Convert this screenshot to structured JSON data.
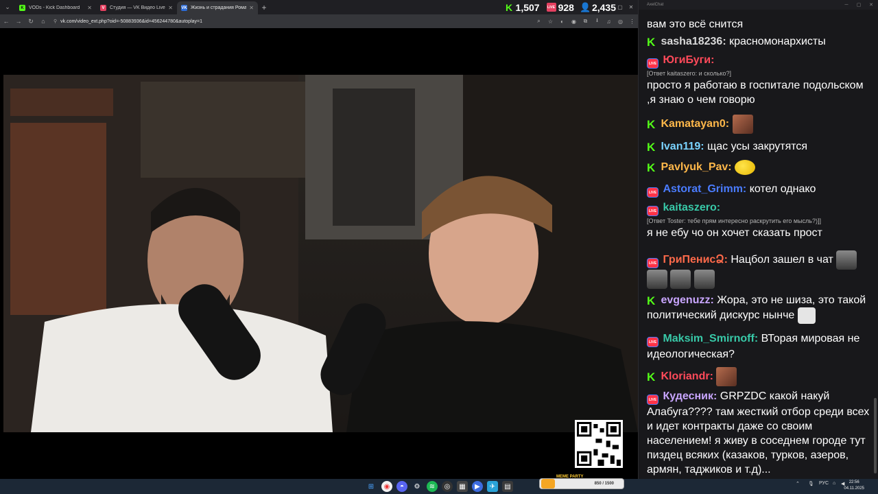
{
  "browser": {
    "tabs": [
      {
        "title": "VODs - Kick Dashboard",
        "favicon_color": "#53fc18",
        "favicon_glyph": "K"
      },
      {
        "title": "Студия — VK Видео Live",
        "favicon_color": "#e54060",
        "favicon_glyph": "V"
      },
      {
        "title": "Жизнь и страдания Рома...",
        "favicon_color": "#2b6bd8",
        "favicon_glyph": "VK",
        "active": true
      }
    ],
    "url": "vk.com/video_ext.php?oid=-50883936&id=456244780&autoplay=1",
    "stats": {
      "kick_viewers": "1,507",
      "vk_viewers": "928",
      "total_viewers": "2,435"
    }
  },
  "chat": {
    "window_title": "AxelChat",
    "messages": [
      {
        "platform": "",
        "nick": "",
        "nick_color": "#ffffff",
        "reply": "",
        "text": "вам это всё снится",
        "emote": ""
      },
      {
        "platform": "kick",
        "nick": "sasha18236:",
        "nick_color": "#d9d9d9",
        "reply": "",
        "text": "красномонархисты",
        "emote": ""
      },
      {
        "platform": "vk",
        "nick": "ЮгиБуги:",
        "nick_color": "#ff4a5a",
        "reply": "[Ответ kaitaszero: и сколько?]",
        "text": "просто я работаю в госпитале подольском ,я знаю о чем говорю",
        "emote": ""
      },
      {
        "platform": "kick",
        "nick": "Kamatayan0:",
        "nick_color": "#ffb84a",
        "reply": "",
        "text": "",
        "emote": "face"
      },
      {
        "platform": "kick",
        "nick": "Ivan119:",
        "nick_color": "#7ad3ff",
        "reply": "",
        "text": "щас усы закрутятся",
        "emote": ""
      },
      {
        "platform": "kick",
        "nick": "Pavlyuk_Pav:",
        "nick_color": "#ffb84a",
        "reply": "",
        "text": "",
        "emote": "yellow"
      },
      {
        "platform": "vk",
        "nick": "Astorat_Grimm:",
        "nick_color": "#4a7cff",
        "reply": "",
        "text": "котел однако",
        "emote": ""
      },
      {
        "platform": "vk",
        "nick": "kaitaszero:",
        "nick_color": "#38c9a8",
        "reply": "[Ответ Toster: тебе прям интересно раскрутить его мысль?)]]",
        "text": "я не ебу чо он хочет сказать прост",
        "emote": ""
      },
      {
        "platform": "vk",
        "nick": "ГриПенисՁ:",
        "nick_color": "#ff6a4a",
        "reply": "",
        "text": "Нацбол зашел в чат",
        "emote": "pepe"
      },
      {
        "platform": "kick",
        "nick": "evgenuzz:",
        "nick_color": "#c9a6ff",
        "reply": "",
        "text": "Жора, это не шиза, это такой политический дискурс нынче",
        "emote": "meme"
      },
      {
        "platform": "vk",
        "nick": "Maksim_Smirnoff:",
        "nick_color": "#38c9a8",
        "reply": "",
        "text": "ВТорая мировая не идеологическая?",
        "emote": ""
      },
      {
        "platform": "kick",
        "nick": "Kloriandr:",
        "nick_color": "#ff4a5a",
        "reply": "",
        "text": "",
        "emote": "face"
      },
      {
        "platform": "vk",
        "nick": "Кудесник:",
        "nick_color": "#c9a6ff",
        "reply": "",
        "text": "GRPZDC какой накуй Алабуга???? там жесткий отбор среди всех и идет контракты даже со своим населением! я живу в соседнем городе тут пиздец всяких (казаков, турков, азеров, армян, таджиков и т.д)...",
        "emote": ""
      }
    ]
  },
  "taskbar": {
    "meme_party_label": "MEME PARTY",
    "meme_party_count": "850 / 1500",
    "language": "РУС",
    "time": "22:56",
    "date": "04.11.2025"
  }
}
